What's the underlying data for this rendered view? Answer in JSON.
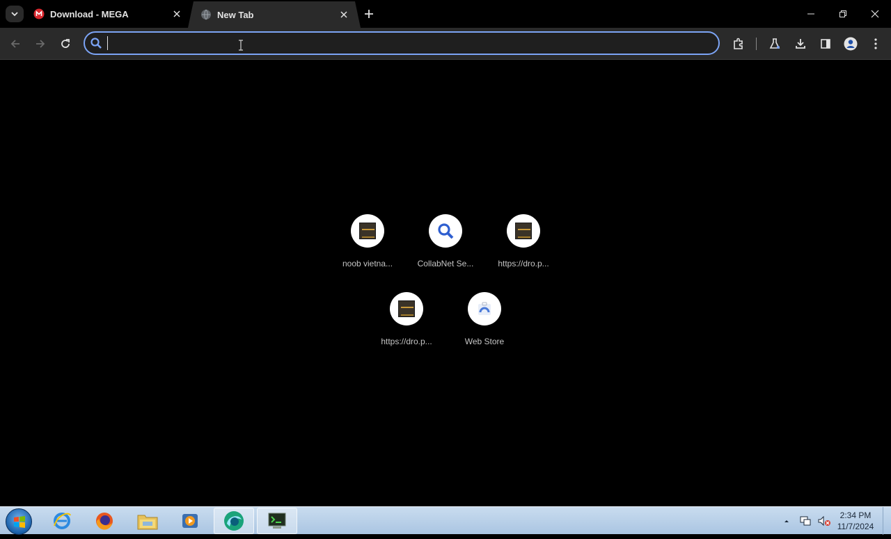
{
  "tabs": [
    {
      "title": "Download - MEGA",
      "favicon": "mega-icon",
      "active": false
    },
    {
      "title": "New Tab",
      "favicon": "globe-icon",
      "active": true
    }
  ],
  "window_controls": [
    "minimize-icon",
    "restore-icon",
    "close-icon"
  ],
  "toolbar": {
    "omnibox": {
      "value": "",
      "placeholder": ""
    },
    "right_icons": [
      "extensions-icon",
      "labs-icon",
      "download-icon",
      "side-panel-icon",
      "profile-icon",
      "more-menu-icon"
    ]
  },
  "shortcuts": [
    {
      "label": "noob vietna...",
      "icon": "site-thumbnail-icon"
    },
    {
      "label": "CollabNet Se...",
      "icon": "search-icon"
    },
    {
      "label": "https://dro.p...",
      "icon": "site-thumbnail-icon"
    },
    {
      "label": "https://dro.p...",
      "icon": "site-thumbnail-icon"
    },
    {
      "label": "Web Store",
      "icon": "web-store-icon"
    }
  ],
  "taskbar": {
    "apps": [
      "internet-explorer-icon",
      "firefox-icon",
      "file-explorer-icon",
      "media-player-icon",
      "browser-app-icon",
      "terminal-app-icon"
    ],
    "clock": {
      "time": "2:34 PM",
      "date": "11/7/2024"
    }
  },
  "colors": {
    "omnibox_focus": "#7ca4f5",
    "toolbar_bg": "#2a2a2a",
    "page_bg": "#000000",
    "mega_red": "#d9272e"
  }
}
